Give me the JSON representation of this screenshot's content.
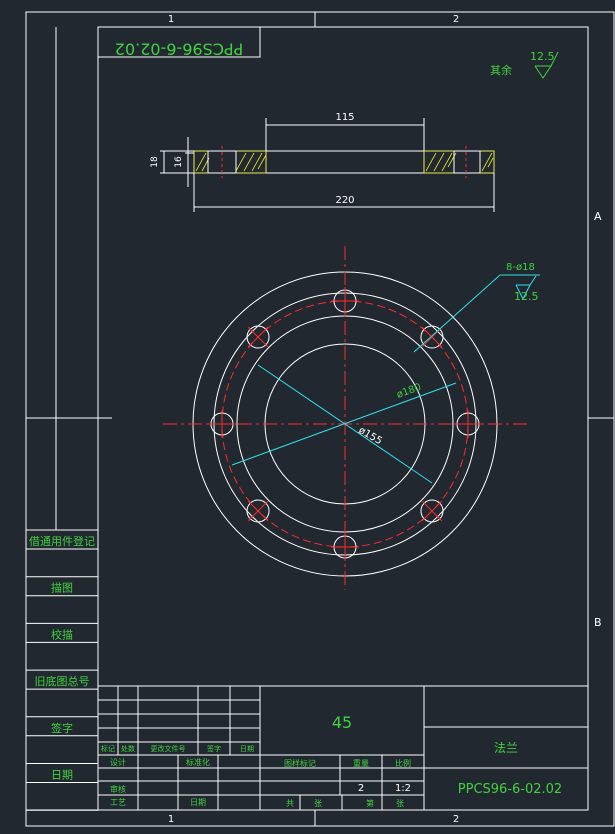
{
  "title_block": {
    "part_no_mirrored": "PPCS96-6-02.02",
    "part_name": "法兰",
    "drawing_no": "PPCS96-6-02.02",
    "material": "45",
    "weight_value": "2",
    "scale_value": "1:2",
    "col_stage_mark": "图样标记",
    "col_weight": "重量",
    "col_scale": "比例",
    "sheet_total": "共",
    "sheet_label": "张",
    "sheet_no": "第",
    "sheet_label2": "张",
    "rev_mark": "标记",
    "rev_count": "处数",
    "rev_doc": "更改文件号",
    "rev_sign": "签字",
    "rev_date": "日期",
    "designer": "设计",
    "standardize": "标准化",
    "checker": "审核",
    "process": "工艺",
    "date_label": "日期"
  },
  "side_panel": {
    "items": [
      "借通用件登记",
      "描图",
      "校描",
      "旧底图总号",
      "签字",
      "日期"
    ]
  },
  "zones": {
    "top_1": "1",
    "top_2": "2",
    "bottom_1": "1",
    "bottom_2": "2",
    "side_a": "A",
    "side_b": "B"
  },
  "surface": {
    "other_label": "其余",
    "other_value": "12.5",
    "hole_value": "12.5"
  },
  "dimensions": {
    "inner_width": "115",
    "outer_width": "220",
    "thickness_total": "18",
    "thickness_flange": "16",
    "holes": "8-ø18",
    "bolt_circle": "ø180",
    "bore": "ø155"
  },
  "colors": {
    "background": "#212830",
    "line": "#ffffff",
    "text": "#3fd23f",
    "dimension": "#2fe0e8",
    "centerline": "#ff2a2a",
    "hatch": "#e6e62a"
  }
}
